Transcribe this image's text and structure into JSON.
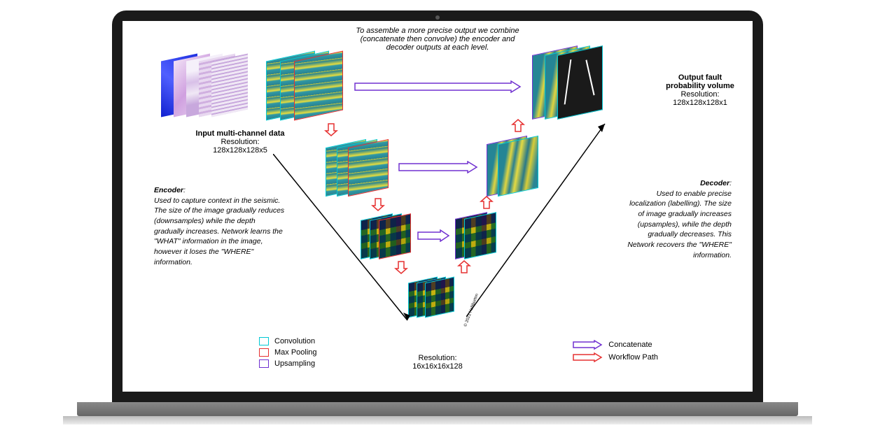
{
  "top_caption": "To assemble a more precise output we combine (concatenate then convolve) the encoder and decoder outputs at each level.",
  "input": {
    "title": "Input multi-channel data",
    "res_label": "Resolution:",
    "res_value": "128x128x128x5"
  },
  "output": {
    "title": "Output fault probability volume",
    "res_label": "Resolution:",
    "res_value": "128x128x128x1"
  },
  "encoder": {
    "title": "Encoder",
    "body": "Used to capture context in the seismic. The size of the image gradually reduces (downsamples) while the depth gradually increases. Network learns the \"WHAT\" information in the image, however it loses the \"WHERE\" information."
  },
  "decoder": {
    "title": "Decoder",
    "body": "Used to enable precise localization (labelling). The size of image gradually increases (upsamples), while the depth gradually decreases. This Network recovers the \"WHERE\" information."
  },
  "bottom": {
    "res_label": "Resolution:",
    "res_value": "16x16x16x128"
  },
  "legend": {
    "conv": "Convolution",
    "maxpool": "Max Pooling",
    "upsample": "Upsampling",
    "concat": "Concatenate",
    "workflow": "Workflow Path"
  },
  "copyright": "© 2021 Halliburton"
}
